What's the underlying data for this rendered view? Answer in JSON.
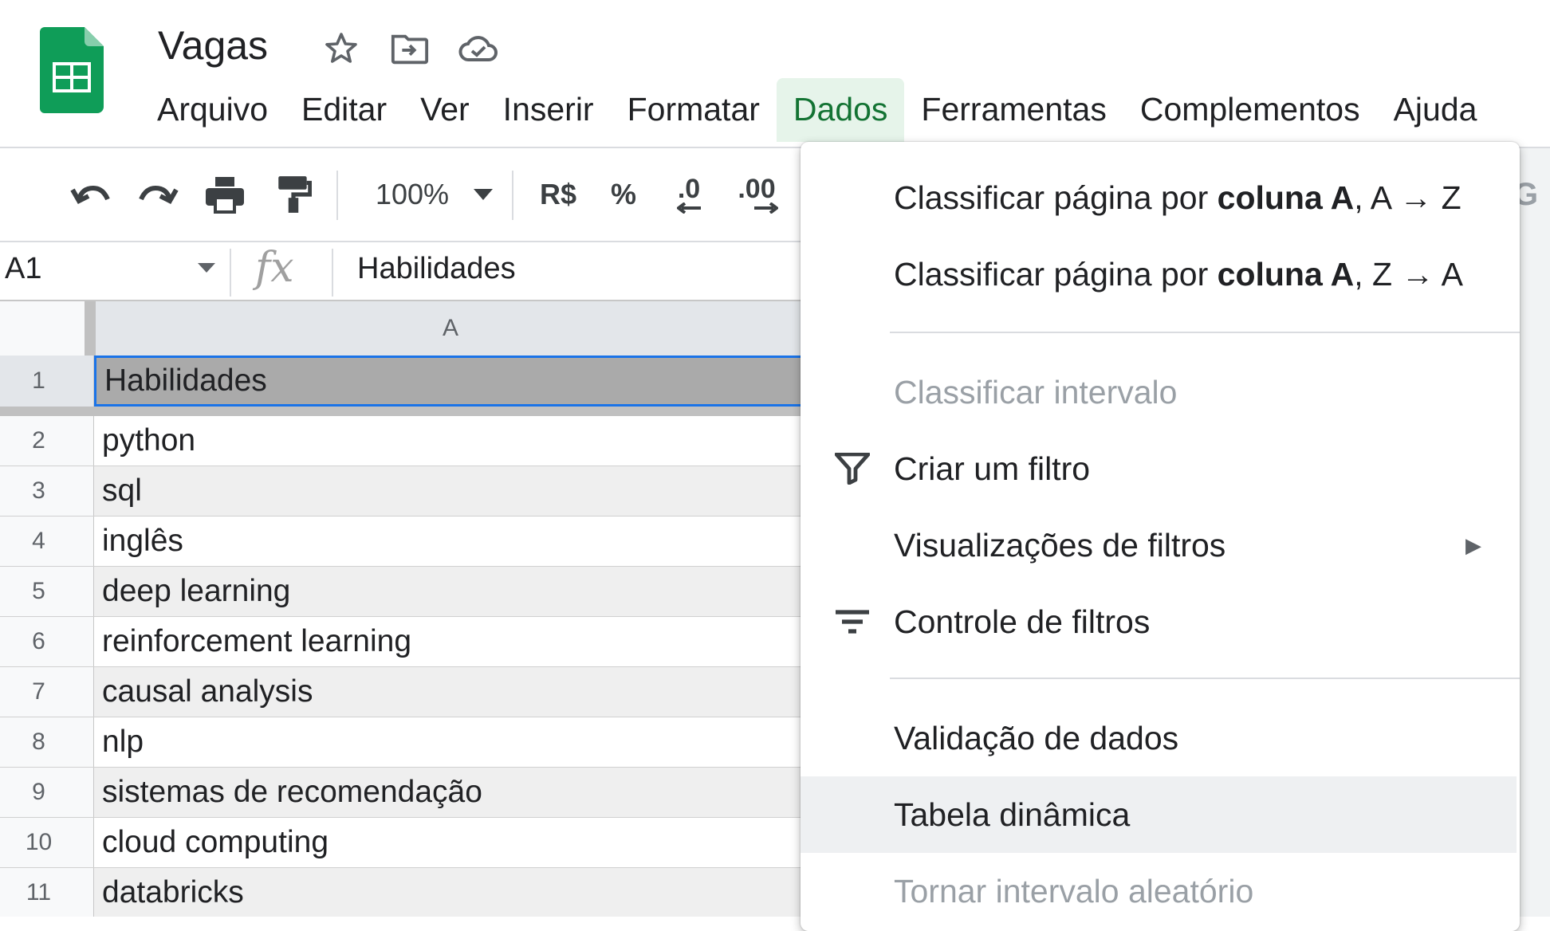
{
  "doc": {
    "title": "Vagas",
    "icons": [
      "star-icon",
      "move-to-folder-icon",
      "cloud-saved-icon"
    ]
  },
  "menu": [
    "Arquivo",
    "Editar",
    "Ver",
    "Inserir",
    "Formatar",
    "Dados",
    "Ferramentas",
    "Complementos",
    "Ajuda"
  ],
  "menu_active": "Dados",
  "toolbar": {
    "zoom": "100%",
    "currency": "R$",
    "percent": "%",
    "decrease_decimals": ".0",
    "increase_decimals": ".00",
    "icons": [
      "undo-icon",
      "redo-icon",
      "print-icon",
      "paint-format-icon",
      "zoom-caret-icon"
    ]
  },
  "formula_bar": {
    "cell_ref": "A1",
    "fx": "fx",
    "value": "Habilidades"
  },
  "grid": {
    "column_header": "A",
    "rows": [
      {
        "num": "1",
        "value": "Habilidades"
      },
      {
        "num": "2",
        "value": "python"
      },
      {
        "num": "3",
        "value": "sql"
      },
      {
        "num": "4",
        "value": "inglês"
      },
      {
        "num": "5",
        "value": "deep learning"
      },
      {
        "num": "6",
        "value": "reinforcement learning"
      },
      {
        "num": "7",
        "value": "causal analysis"
      },
      {
        "num": "8",
        "value": "nlp"
      },
      {
        "num": "9",
        "value": "sistemas de recomendação"
      },
      {
        "num": "10",
        "value": "cloud computing"
      },
      {
        "num": "11",
        "value": "databricks"
      }
    ]
  },
  "dropdown": {
    "sort_az": {
      "prefix": "Classificar página por ",
      "bold": "coluna A",
      "suffix": ", A → Z"
    },
    "sort_za": {
      "prefix": "Classificar página por ",
      "bold": "coluna A",
      "suffix": ", Z → A"
    },
    "sort_range": "Classificar intervalo",
    "create_filter": "Criar um filtro",
    "filter_views": "Visualizações de filtros",
    "filter_controls": "Controle de filtros",
    "data_validation": "Validação de dados",
    "pivot_table": "Tabela dinâmica",
    "randomize_range": "Tornar intervalo aleatório"
  },
  "colors": {
    "sheets_green": "#0f9d58",
    "active_menu_bg": "#e6f4ea",
    "active_menu_text": "#137333",
    "selection_blue": "#1a73e8"
  }
}
